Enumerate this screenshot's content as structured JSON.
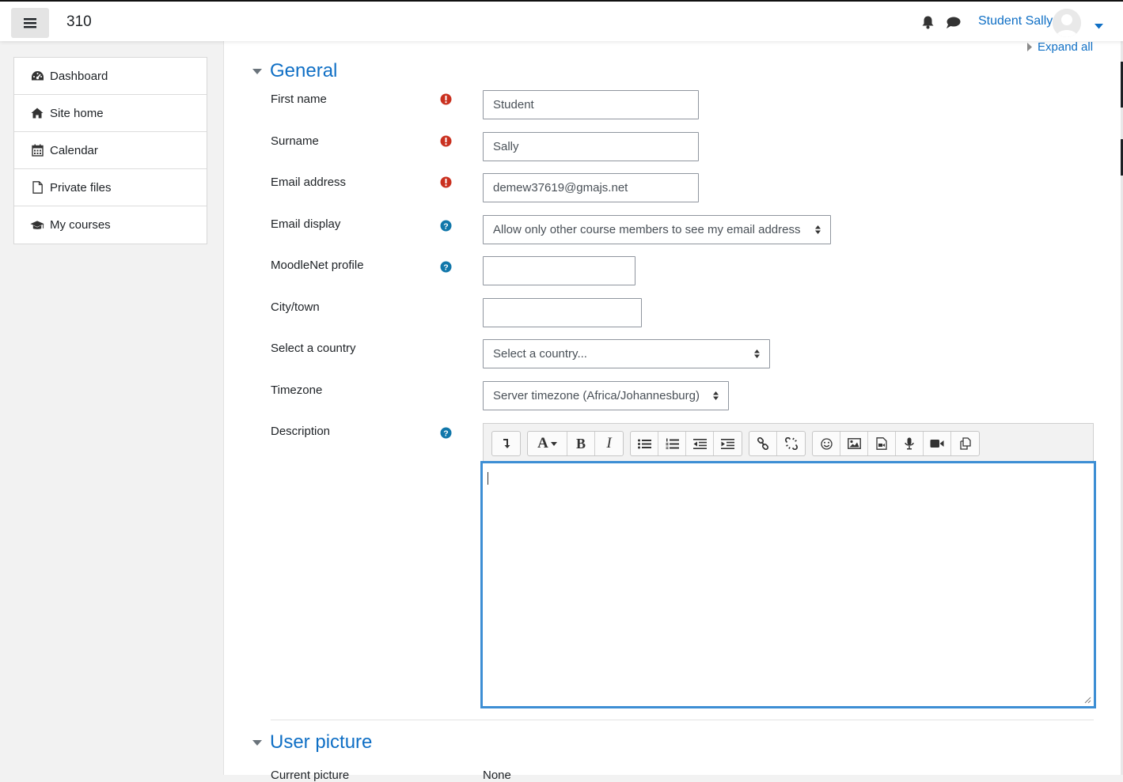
{
  "navbar": {
    "site_name": "310",
    "user_name": "Student Sally",
    "icons": {
      "menu": "hamburger-icon",
      "notifications": "bell-icon",
      "messages": "chat-bubble-icon",
      "user_menu": "caret-down-icon"
    }
  },
  "sidebar": {
    "items": [
      {
        "label": "Dashboard",
        "icon": "dashboard-icon"
      },
      {
        "label": "Site home",
        "icon": "home-icon"
      },
      {
        "label": "Calendar",
        "icon": "calendar-icon"
      },
      {
        "label": "Private files",
        "icon": "file-icon"
      },
      {
        "label": "My courses",
        "icon": "graduation-cap-icon"
      }
    ]
  },
  "form": {
    "expand_all": "Expand all",
    "section_general": "General",
    "fields": {
      "first_name": {
        "label": "First name",
        "value": "Student"
      },
      "surname": {
        "label": "Surname",
        "value": "Sally"
      },
      "email": {
        "label": "Email address",
        "value": "demew37619@gmajs.net"
      },
      "email_display": {
        "label": "Email display",
        "value": "Allow only other course members to see my email address"
      },
      "moodlenet": {
        "label": "MoodleNet profile",
        "value": ""
      },
      "city": {
        "label": "City/town",
        "value": ""
      },
      "country": {
        "label": "Select a country",
        "value": "Select a country..."
      },
      "timezone": {
        "label": "Timezone",
        "value": "Server timezone (Africa/Johannesburg)"
      },
      "description": {
        "label": "Description",
        "value": ""
      }
    },
    "editor_toolbar": [
      [
        "collapse-icon"
      ],
      [
        "font-style-icon",
        "bold-icon",
        "italic-icon"
      ],
      [
        "unordered-list-icon",
        "ordered-list-icon",
        "outdent-icon",
        "indent-icon"
      ],
      [
        "link-icon",
        "unlink-icon"
      ],
      [
        "emoji-icon",
        "image-icon",
        "media-icon",
        "microphone-icon",
        "video-icon",
        "manage-files-icon"
      ]
    ],
    "toolbar_glyphs": {
      "font": "A",
      "bold": "B",
      "italic": "I"
    },
    "section_user_picture": "User picture",
    "current_picture": {
      "label": "Current picture",
      "value": "None"
    }
  },
  "colors": {
    "link": "#0f6fc5",
    "required": "#ca3120",
    "help": "#1177aa",
    "focus": "#3d8ed4"
  }
}
